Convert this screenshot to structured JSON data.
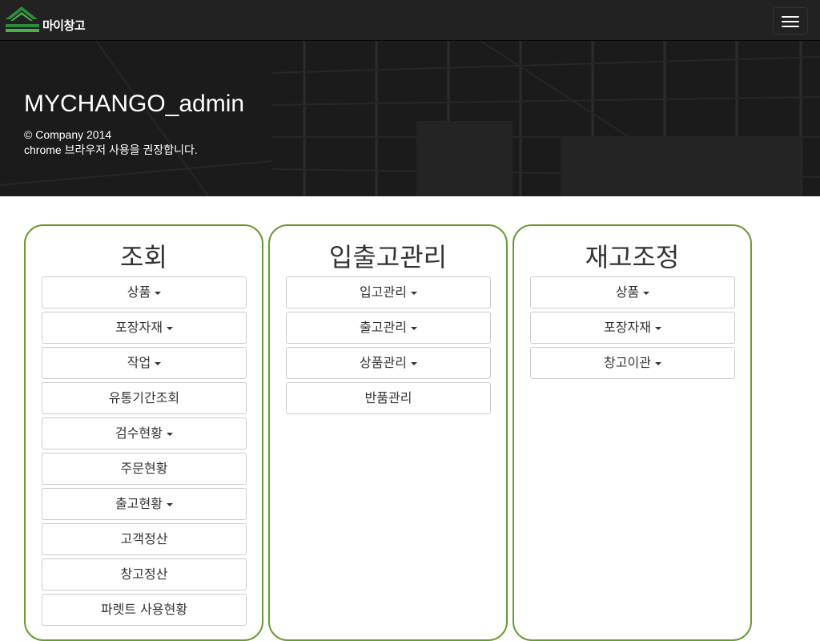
{
  "navbar": {
    "logo_text": "마이창고",
    "logo_icon": "warehouse-roof-icon",
    "menu_icon": "hamburger-menu-icon"
  },
  "hero": {
    "title": "MYCHANGO_admin",
    "copyright": "© Company 2014",
    "notice": "chrome 브라우저 사용을 권장합니다."
  },
  "colors": {
    "navbar": "#222222",
    "panel_border": "#6a9a32",
    "logo_green": "#2e8b3e"
  },
  "panels": [
    {
      "title": "조회",
      "items": [
        {
          "label": "상품",
          "dropdown": true
        },
        {
          "label": "포장자재",
          "dropdown": true
        },
        {
          "label": "작업",
          "dropdown": true
        },
        {
          "label": "유통기간조회",
          "dropdown": false
        },
        {
          "label": "검수현황",
          "dropdown": true
        },
        {
          "label": "주문현황",
          "dropdown": false
        },
        {
          "label": "출고현황",
          "dropdown": true
        },
        {
          "label": "고객정산",
          "dropdown": false
        },
        {
          "label": "창고정산",
          "dropdown": false
        },
        {
          "label": "파렛트 사용현황",
          "dropdown": false
        }
      ]
    },
    {
      "title": "입출고관리",
      "items": [
        {
          "label": "입고관리",
          "dropdown": true
        },
        {
          "label": "출고관리",
          "dropdown": true
        },
        {
          "label": "상품관리",
          "dropdown": true
        },
        {
          "label": "반품관리",
          "dropdown": false
        }
      ]
    },
    {
      "title": "재고조정",
      "items": [
        {
          "label": "상품",
          "dropdown": true
        },
        {
          "label": "포장자재",
          "dropdown": true
        },
        {
          "label": "창고이관",
          "dropdown": true
        }
      ]
    }
  ]
}
